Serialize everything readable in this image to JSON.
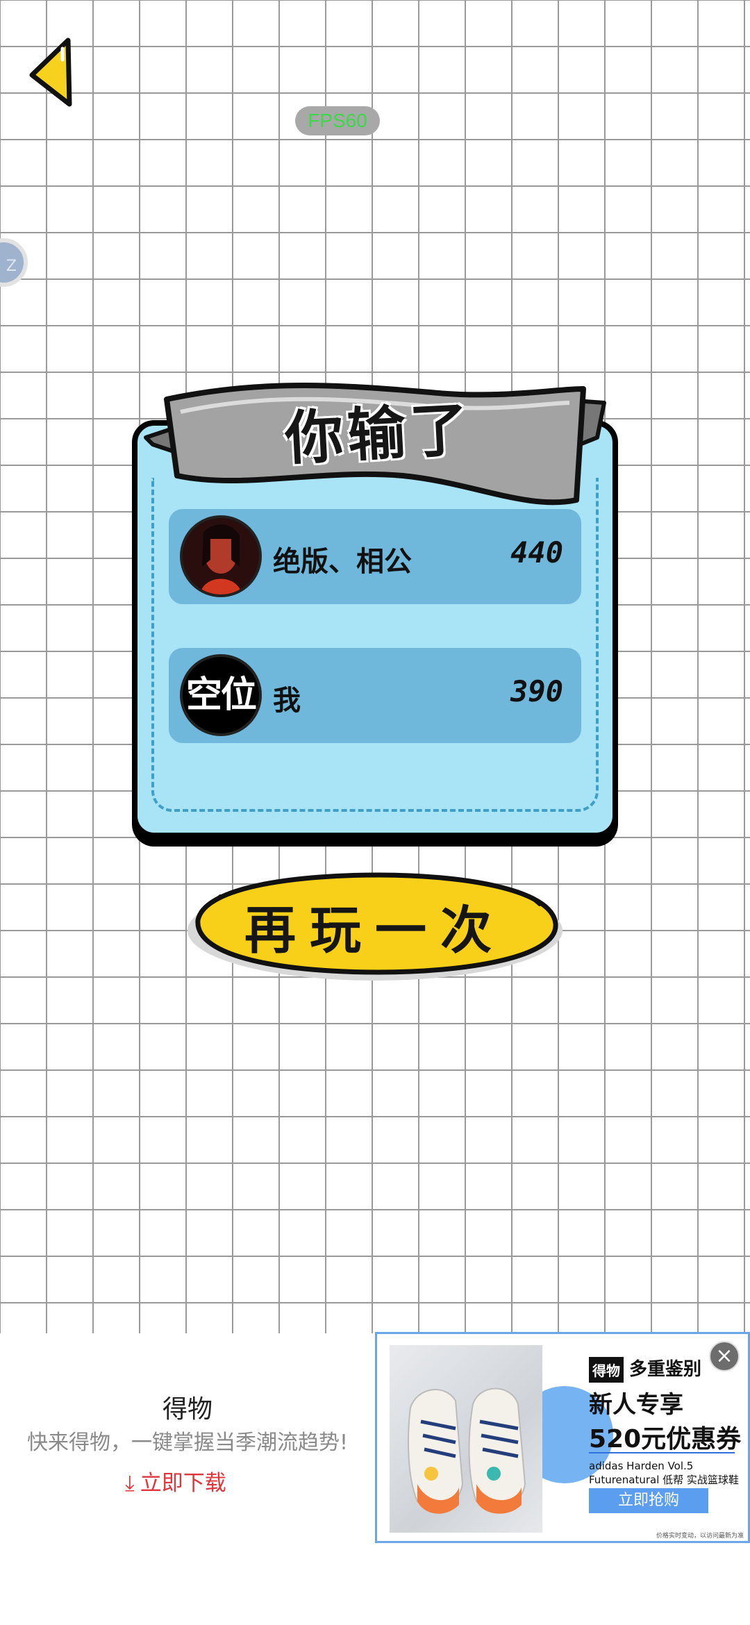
{
  "hud": {
    "fps": "FPS60",
    "side_bubble": "Z"
  },
  "result": {
    "title": "你输了",
    "players": [
      {
        "name": "绝版、相公",
        "score": "440",
        "avatar": "player-photo"
      },
      {
        "name": "我",
        "score": "390",
        "avatar_text": "空位"
      }
    ],
    "replay_label": "再玩一次"
  },
  "ad": {
    "app_name": "得物",
    "description": "快来得物，一键掌握当季潮流趋势!",
    "download_label": "立即下载",
    "brand_logo": "得物",
    "brand_tag": "多重鉴别",
    "headline": "新人专享",
    "coupon": "520元优惠券",
    "product": "adidas Harden Vol.5 Futurenatural 低帮 实战篮球鞋",
    "cta": "立即抢购",
    "note": "价格实时变动，以访问最新为准",
    "close": "×"
  },
  "colors": {
    "panel": "#a8e4f6",
    "row": "#6fb8db",
    "button": "#f8d01a",
    "accent_red": "#e0353d"
  }
}
